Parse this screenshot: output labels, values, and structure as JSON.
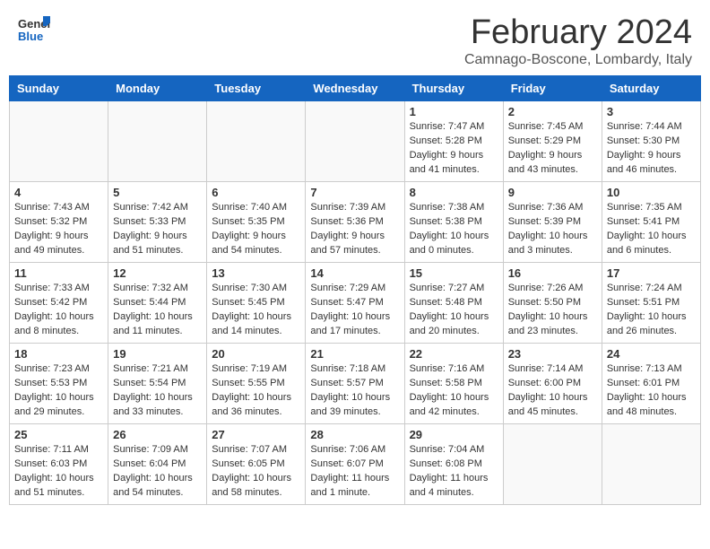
{
  "header": {
    "logo_general": "General",
    "logo_blue": "Blue",
    "month_year": "February 2024",
    "location": "Camnago-Boscone, Lombardy, Italy"
  },
  "days_of_week": [
    "Sunday",
    "Monday",
    "Tuesday",
    "Wednesday",
    "Thursday",
    "Friday",
    "Saturday"
  ],
  "weeks": [
    [
      {
        "num": "",
        "info": "",
        "empty": true
      },
      {
        "num": "",
        "info": "",
        "empty": true
      },
      {
        "num": "",
        "info": "",
        "empty": true
      },
      {
        "num": "",
        "info": "",
        "empty": true
      },
      {
        "num": "1",
        "info": "Sunrise: 7:47 AM\nSunset: 5:28 PM\nDaylight: 9 hours\nand 41 minutes."
      },
      {
        "num": "2",
        "info": "Sunrise: 7:45 AM\nSunset: 5:29 PM\nDaylight: 9 hours\nand 43 minutes."
      },
      {
        "num": "3",
        "info": "Sunrise: 7:44 AM\nSunset: 5:30 PM\nDaylight: 9 hours\nand 46 minutes."
      }
    ],
    [
      {
        "num": "4",
        "info": "Sunrise: 7:43 AM\nSunset: 5:32 PM\nDaylight: 9 hours\nand 49 minutes."
      },
      {
        "num": "5",
        "info": "Sunrise: 7:42 AM\nSunset: 5:33 PM\nDaylight: 9 hours\nand 51 minutes."
      },
      {
        "num": "6",
        "info": "Sunrise: 7:40 AM\nSunset: 5:35 PM\nDaylight: 9 hours\nand 54 minutes."
      },
      {
        "num": "7",
        "info": "Sunrise: 7:39 AM\nSunset: 5:36 PM\nDaylight: 9 hours\nand 57 minutes."
      },
      {
        "num": "8",
        "info": "Sunrise: 7:38 AM\nSunset: 5:38 PM\nDaylight: 10 hours\nand 0 minutes."
      },
      {
        "num": "9",
        "info": "Sunrise: 7:36 AM\nSunset: 5:39 PM\nDaylight: 10 hours\nand 3 minutes."
      },
      {
        "num": "10",
        "info": "Sunrise: 7:35 AM\nSunset: 5:41 PM\nDaylight: 10 hours\nand 6 minutes."
      }
    ],
    [
      {
        "num": "11",
        "info": "Sunrise: 7:33 AM\nSunset: 5:42 PM\nDaylight: 10 hours\nand 8 minutes."
      },
      {
        "num": "12",
        "info": "Sunrise: 7:32 AM\nSunset: 5:44 PM\nDaylight: 10 hours\nand 11 minutes."
      },
      {
        "num": "13",
        "info": "Sunrise: 7:30 AM\nSunset: 5:45 PM\nDaylight: 10 hours\nand 14 minutes."
      },
      {
        "num": "14",
        "info": "Sunrise: 7:29 AM\nSunset: 5:47 PM\nDaylight: 10 hours\nand 17 minutes."
      },
      {
        "num": "15",
        "info": "Sunrise: 7:27 AM\nSunset: 5:48 PM\nDaylight: 10 hours\nand 20 minutes."
      },
      {
        "num": "16",
        "info": "Sunrise: 7:26 AM\nSunset: 5:50 PM\nDaylight: 10 hours\nand 23 minutes."
      },
      {
        "num": "17",
        "info": "Sunrise: 7:24 AM\nSunset: 5:51 PM\nDaylight: 10 hours\nand 26 minutes."
      }
    ],
    [
      {
        "num": "18",
        "info": "Sunrise: 7:23 AM\nSunset: 5:53 PM\nDaylight: 10 hours\nand 29 minutes."
      },
      {
        "num": "19",
        "info": "Sunrise: 7:21 AM\nSunset: 5:54 PM\nDaylight: 10 hours\nand 33 minutes."
      },
      {
        "num": "20",
        "info": "Sunrise: 7:19 AM\nSunset: 5:55 PM\nDaylight: 10 hours\nand 36 minutes."
      },
      {
        "num": "21",
        "info": "Sunrise: 7:18 AM\nSunset: 5:57 PM\nDaylight: 10 hours\nand 39 minutes."
      },
      {
        "num": "22",
        "info": "Sunrise: 7:16 AM\nSunset: 5:58 PM\nDaylight: 10 hours\nand 42 minutes."
      },
      {
        "num": "23",
        "info": "Sunrise: 7:14 AM\nSunset: 6:00 PM\nDaylight: 10 hours\nand 45 minutes."
      },
      {
        "num": "24",
        "info": "Sunrise: 7:13 AM\nSunset: 6:01 PM\nDaylight: 10 hours\nand 48 minutes."
      }
    ],
    [
      {
        "num": "25",
        "info": "Sunrise: 7:11 AM\nSunset: 6:03 PM\nDaylight: 10 hours\nand 51 minutes."
      },
      {
        "num": "26",
        "info": "Sunrise: 7:09 AM\nSunset: 6:04 PM\nDaylight: 10 hours\nand 54 minutes."
      },
      {
        "num": "27",
        "info": "Sunrise: 7:07 AM\nSunset: 6:05 PM\nDaylight: 10 hours\nand 58 minutes."
      },
      {
        "num": "28",
        "info": "Sunrise: 7:06 AM\nSunset: 6:07 PM\nDaylight: 11 hours\nand 1 minute."
      },
      {
        "num": "29",
        "info": "Sunrise: 7:04 AM\nSunset: 6:08 PM\nDaylight: 11 hours\nand 4 minutes."
      },
      {
        "num": "",
        "info": "",
        "empty": true
      },
      {
        "num": "",
        "info": "",
        "empty": true
      }
    ]
  ]
}
